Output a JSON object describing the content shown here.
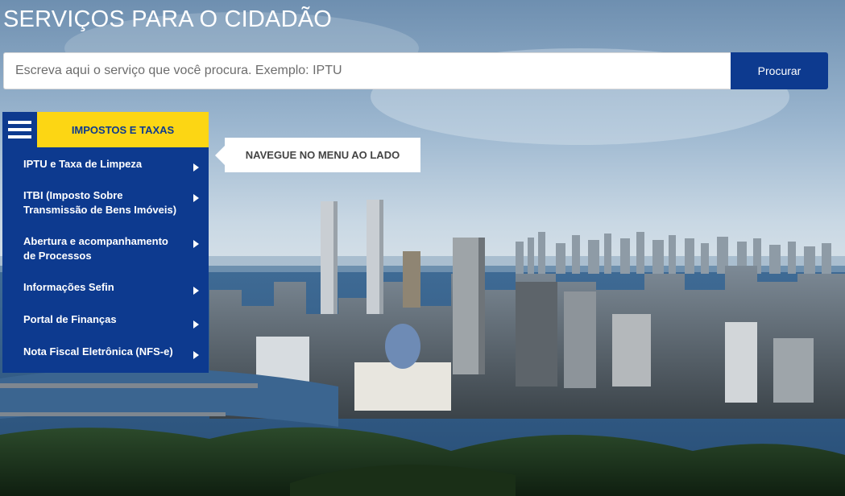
{
  "header": {
    "title": "SERVIÇOS PARA O CIDADÃO"
  },
  "search": {
    "placeholder": "Escreva aqui o serviço que você procura. Exemplo: IPTU",
    "value": "",
    "button_label": "Procurar"
  },
  "menu": {
    "category": "IMPOSTOS E TAXAS",
    "items": [
      {
        "label": "IPTU e Taxa de Limpeza"
      },
      {
        "label": "ITBI (Imposto Sobre Transmissão de Bens Imóveis)"
      },
      {
        "label": "Abertura e acompanhamento de Processos"
      },
      {
        "label": "Informações Sefin"
      },
      {
        "label": "Portal de Finanças"
      },
      {
        "label": "Nota Fiscal Eletrônica (NFS-e)"
      }
    ]
  },
  "hint": {
    "text": "NAVEGUE NO MENU AO LADO"
  },
  "colors": {
    "primary_blue": "#0d3a8f",
    "accent_yellow": "#fcd614",
    "text_white": "#ffffff"
  },
  "icons": {
    "menu": "hamburger-icon",
    "submenu_arrow": "triangle-right-icon"
  }
}
